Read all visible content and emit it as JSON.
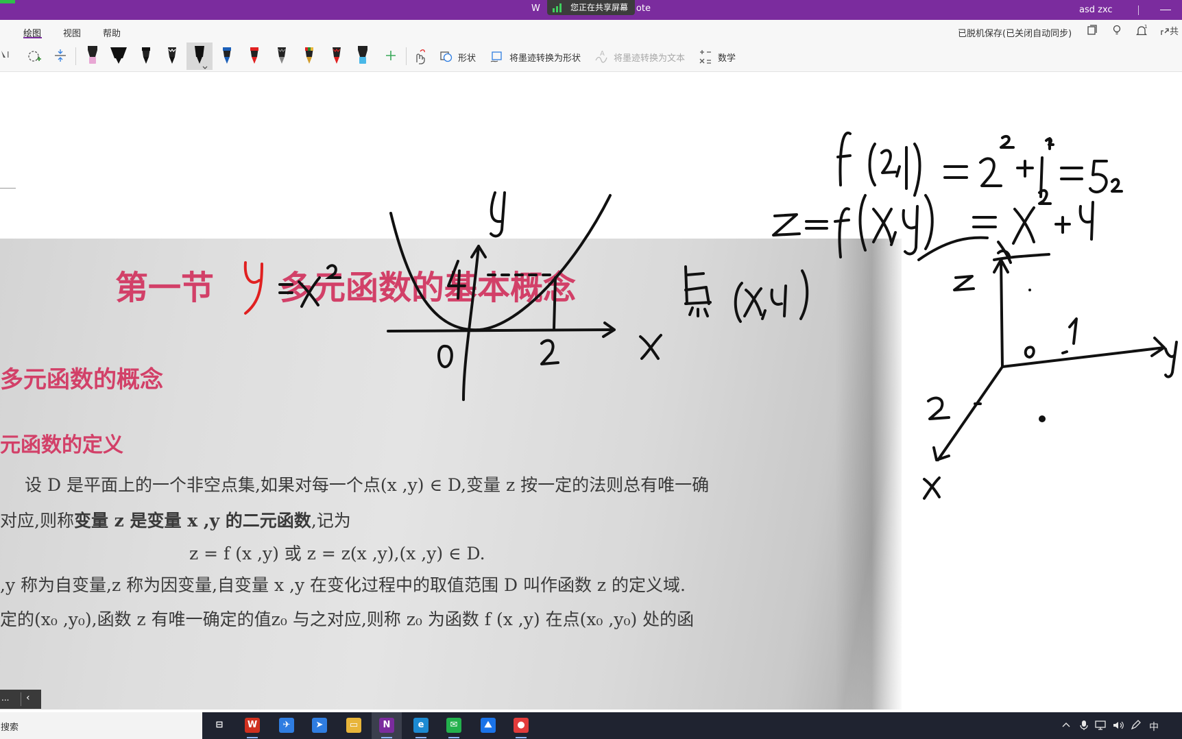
{
  "window": {
    "title_left": "W",
    "title_right": "ote",
    "share_banner": "您正在共享屏幕",
    "user": "asd zxc"
  },
  "ribbon": {
    "tabs": [
      {
        "label": "绘图",
        "active": true
      },
      {
        "label": "视图",
        "active": false
      },
      {
        "label": "帮助",
        "active": false
      }
    ],
    "sync_status": "已脱机保存(已关闭自动同步)",
    "share_label": "共"
  },
  "toolbar": {
    "shapes_label": "形状",
    "ink_to_shape_label": "将墨迹转换为形状",
    "ink_to_text_label": "将墨迹转换为文本",
    "math_label": "数学",
    "pens": [
      {
        "color": "#e8a7d4",
        "kind": "highlighter"
      },
      {
        "color": "#111111",
        "kind": "marker-wide"
      },
      {
        "color": "#111111",
        "kind": "pen"
      },
      {
        "color": "#111111",
        "kind": "pen-fancy"
      },
      {
        "color": "#111111",
        "kind": "pen-selected"
      },
      {
        "color": "#1b5fb8",
        "kind": "pen"
      },
      {
        "color": "#e02020",
        "kind": "pen"
      },
      {
        "color": "#888888",
        "kind": "pen-fancy"
      },
      {
        "color": "#d19b2a",
        "kind": "pen-multi"
      },
      {
        "color": "#e02020",
        "kind": "pen-fancy"
      },
      {
        "color": "#49b8e8",
        "kind": "highlighter"
      }
    ]
  },
  "photo": {
    "heading": "第一节　　多元函数的基本概念",
    "sub_heading": "多元函数的概念",
    "sub_sub_heading": "元函数的定义",
    "line1": "设 D 是平面上的一个非空点集,如果对每一个点(x ,y) ∈ D,变量 z 按一定的法则总有唯一确",
    "line2_a": "对应,则称",
    "line2_b": "变量 z 是变量 x ,y 的二元函数",
    "line2_c": ",记为",
    "formula": "z = f (x ,y) 或 z = z(x ,y),(x ,y) ∈ D.",
    "line4": ",y 称为自变量,z 称为因变量,自变量 x ,y 在变化过程中的取值范围 D 叫作函数 z 的定义域.",
    "line5": "定的(x₀ ,y₀),函数 z 有唯一确定的值z₀ 与之对应,则称 z₀ 为函数 f (x ,y) 在点(x₀ ,y₀) 处的函"
  },
  "ink": {
    "f21": "f(2,1) = 2² + 1² = 5",
    "zfxy": "Z = f(x,y) = x² + y²",
    "y_eq": "y = x²",
    "point": "点 (x,y)",
    "graph_labels": {
      "y": "y",
      "four": "4",
      "zero": "0",
      "two": "2",
      "x": "x"
    },
    "axes3d_labels": {
      "z": "z",
      "zero": "0",
      "two": "2",
      "one": "1",
      "x": "x",
      "y": "y"
    }
  },
  "page_nav": {
    "more": "...",
    "collapse": "‹"
  },
  "taskbar": {
    "search_text": "搜索",
    "ime": "中",
    "apps": [
      {
        "name": "task-view",
        "glyph": "⊟",
        "color": "#1f2330"
      },
      {
        "name": "wps",
        "glyph": "W",
        "color": "#d0301f"
      },
      {
        "name": "feishu",
        "glyph": "✈",
        "color": "#2f7de1"
      },
      {
        "name": "lark-docs",
        "glyph": "➤",
        "color": "#2f7de1"
      },
      {
        "name": "file-explorer",
        "glyph": "▭",
        "color": "#e8b53a"
      },
      {
        "name": "onenote",
        "glyph": "N",
        "color": "#7b2c9e"
      },
      {
        "name": "edge",
        "glyph": "e",
        "color": "#1c8ad2"
      },
      {
        "name": "wechat",
        "glyph": "✉",
        "color": "#23b14d"
      },
      {
        "name": "photos",
        "glyph": "⛰",
        "color": "#1a73e8"
      },
      {
        "name": "recorder",
        "glyph": "●",
        "color": "#e23b3b"
      }
    ]
  },
  "colors": {
    "accent": "#7b2c9e",
    "ink_black": "#111111",
    "ink_red": "#e02020"
  }
}
